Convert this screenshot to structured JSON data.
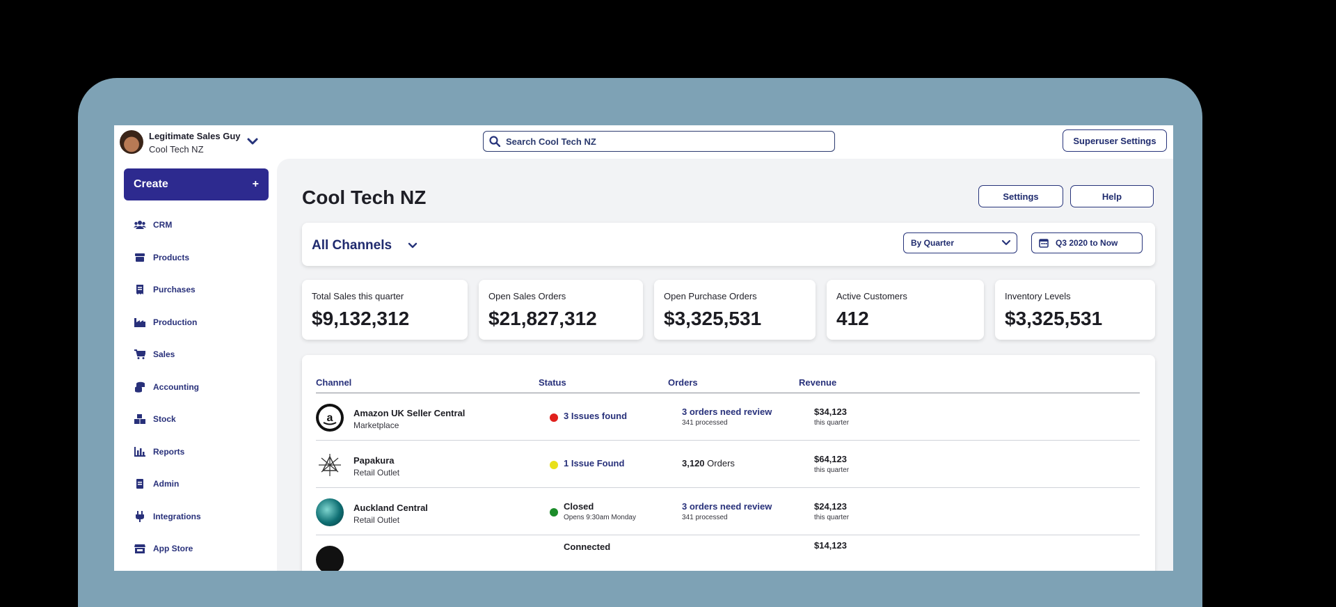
{
  "user": {
    "name": "Legitimate Sales Guy",
    "company": "Cool Tech NZ"
  },
  "search": {
    "placeholder": "Search Cool Tech NZ"
  },
  "header": {
    "superuser_label": "Superuser Settings"
  },
  "sidebar": {
    "create_label": "Create",
    "create_plus": "+",
    "items": [
      {
        "label": "CRM",
        "icon": "users-icon"
      },
      {
        "label": "Products",
        "icon": "box-icon"
      },
      {
        "label": "Purchases",
        "icon": "receipt-icon"
      },
      {
        "label": "Production",
        "icon": "factory-icon"
      },
      {
        "label": "Sales",
        "icon": "cart-icon"
      },
      {
        "label": "Accounting",
        "icon": "coins-icon"
      },
      {
        "label": "Stock",
        "icon": "boxes-icon"
      },
      {
        "label": "Reports",
        "icon": "bar-chart-icon"
      },
      {
        "label": "Admin",
        "icon": "briefcase-icon"
      },
      {
        "label": "Integrations",
        "icon": "plug-icon"
      },
      {
        "label": "App Store",
        "icon": "store-icon"
      }
    ]
  },
  "main": {
    "title": "Cool Tech NZ",
    "settings_label": "Settings",
    "help_label": "Help",
    "channel_filter": "All Channels",
    "period_select": "By Quarter",
    "date_range": "Q3 2020 to Now"
  },
  "stats": [
    {
      "label": "Total Sales this quarter",
      "value": "$9,132,312"
    },
    {
      "label": "Open Sales Orders",
      "value": "$21,827,312"
    },
    {
      "label": "Open Purchase Orders",
      "value": "$3,325,531"
    },
    {
      "label": "Active Customers",
      "value": "412"
    },
    {
      "label": "Inventory Levels",
      "value": "$3,325,531"
    }
  ],
  "table": {
    "headers": [
      "Channel",
      "Status",
      "Orders",
      "Revenue"
    ],
    "rows": [
      {
        "name": "Amazon UK Seller Central",
        "type": "Marketplace",
        "status": "3 Issues found",
        "status_color": "#e0201c",
        "orders": "3 orders need review",
        "orders_sub": "341 processed",
        "revenue": "$34,123",
        "revenue_sub": "this quarter"
      },
      {
        "name": "Papakura",
        "type": "Retail Outlet",
        "status": "1 Issue Found",
        "status_color": "#e8e01a",
        "orders_count": "3,120",
        "orders_word": "Orders",
        "revenue": "$64,123",
        "revenue_sub": "this quarter"
      },
      {
        "name": "Auckland Central",
        "type": "Retail Outlet",
        "status": "Closed",
        "status_sub": "Opens 9:30am Monday",
        "status_color": "#1c8c2a",
        "orders": "3 orders need review",
        "orders_sub": "341 processed",
        "revenue": "$24,123",
        "revenue_sub": "this quarter"
      },
      {
        "status": "Connected",
        "revenue": "$14,123"
      }
    ]
  },
  "colors": {
    "frame": "#7ea2b5",
    "accent": "#2d2a8f",
    "link": "#27307a"
  }
}
